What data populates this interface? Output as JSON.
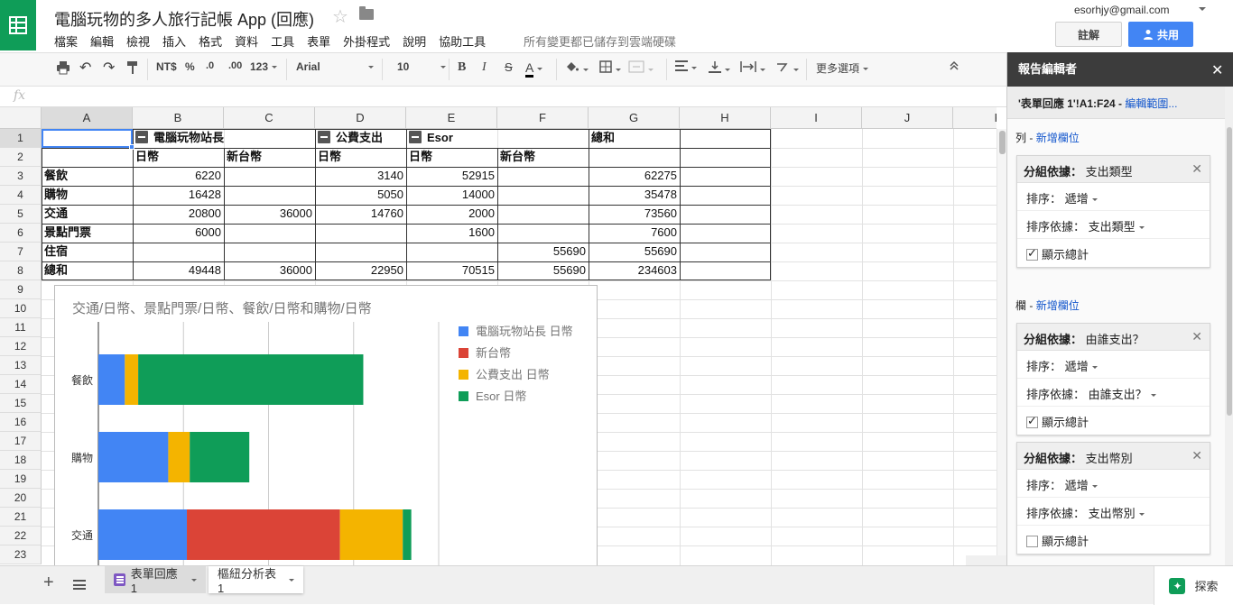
{
  "doc": {
    "title": "電腦玩物的多人旅行記帳 App (回應)",
    "save_status": "所有變更都已儲存到雲端硬碟"
  },
  "menu": [
    "檔案",
    "編輯",
    "檢視",
    "插入",
    "格式",
    "資料",
    "工具",
    "表單",
    "外掛程式",
    "說明",
    "協助工具"
  ],
  "account": {
    "email": "esorhjy@gmail.com",
    "comments_label": "註解",
    "share_label": "共用"
  },
  "toolbar": {
    "currency": "NT$",
    "percent": "%",
    "dec_less": ".0",
    "dec_more": ".00",
    "format_more": "123",
    "font": "Arial",
    "font_size": "10",
    "bold": "B",
    "italic": "I",
    "strike": "S",
    "text_color": "A",
    "more": "更多選項"
  },
  "grid": {
    "columns": [
      "A",
      "B",
      "C",
      "D",
      "E",
      "F",
      "G",
      "H",
      "I",
      "J",
      "K"
    ],
    "rows": [
      "1",
      "2",
      "3",
      "4",
      "5",
      "6",
      "7",
      "8",
      "9",
      "10",
      "11",
      "12",
      "13",
      "14",
      "15",
      "16",
      "17",
      "18",
      "19",
      "20",
      "21",
      "22",
      "23"
    ],
    "row1": [
      "電腦玩物站長",
      "公費支出",
      "Esor",
      "總和"
    ],
    "row2": [
      "日幣",
      "新台幣",
      "日幣",
      "日幣",
      "新台幣"
    ],
    "table": [
      [
        "餐飲",
        "6220",
        "",
        "3140",
        "52915",
        "",
        "62275"
      ],
      [
        "購物",
        "16428",
        "",
        "5050",
        "14000",
        "",
        "35478"
      ],
      [
        "交通",
        "20800",
        "36000",
        "14760",
        "2000",
        "",
        "73560"
      ],
      [
        "景點門票",
        "6000",
        "",
        "",
        "1600",
        "",
        "7600"
      ],
      [
        "住宿",
        "",
        "",
        "",
        "",
        "55690",
        "55690"
      ],
      [
        "總和",
        "49448",
        "36000",
        "22950",
        "70515",
        "55690",
        "234603"
      ]
    ]
  },
  "chart_data": {
    "type": "bar",
    "orientation": "horizontal",
    "stacked": true,
    "title": "交通/日幣、景點門票/日幣、餐飲/日幣和購物/日幣",
    "categories": [
      "餐飲",
      "購物",
      "交通"
    ],
    "series": [
      {
        "name": "電腦玩物站長 日幣",
        "color": "#4285f4",
        "values": [
          6220,
          16428,
          20800
        ]
      },
      {
        "name": "新台幣",
        "color": "#db4437",
        "values": [
          0,
          0,
          36000
        ]
      },
      {
        "name": "公費支出 日幣",
        "color": "#f4b400",
        "values": [
          3140,
          5050,
          14760
        ]
      },
      {
        "name": "Esor 日幣",
        "color": "#0f9d58",
        "values": [
          52915,
          14000,
          2000
        ]
      }
    ],
    "xlim": [
      0,
      80000
    ],
    "grid": true,
    "legend": "right"
  },
  "sheets": {
    "tab1": "表單回應 1",
    "tab2": "樞紐分析表 1",
    "explore": "探索"
  },
  "panel": {
    "title": "報告編輯者",
    "range_ref": "'表單回應 1'!A1:F24 -",
    "range_edit": "編輯範圍...",
    "rows_label": "列 -",
    "cols_label": "欄 -",
    "add_field": "新增欄位",
    "group_label": "分組依據：",
    "order_label": "排序：",
    "sortby_label": "排序依據：",
    "order_value": "遞增",
    "show_totals": "顯示總計",
    "cards": [
      {
        "field": "支出類型",
        "sortby": "支出類型",
        "totals": true
      },
      {
        "field": "由誰支出？",
        "sortby": "由誰支出？",
        "totals": true
      },
      {
        "field": "支出幣別",
        "sortby": "支出幣別",
        "totals": false
      }
    ]
  }
}
